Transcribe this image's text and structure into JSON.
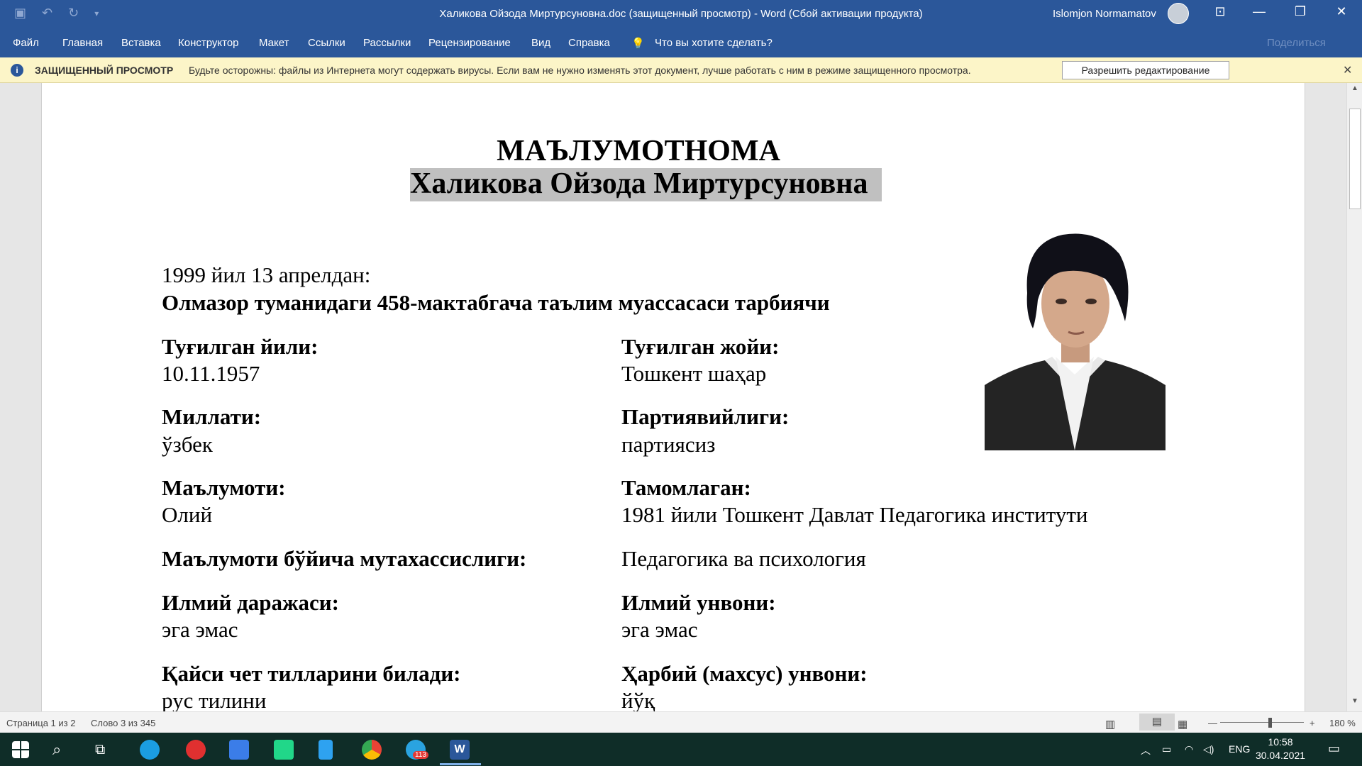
{
  "window": {
    "title": "Халикова Ойзода Миртурсуновна.doc (защищенный просмотр)  -  Word (Сбой активации продукта)",
    "user": "Islomjon Normamatov"
  },
  "menu": [
    "Файл",
    "Главная",
    "Вставка",
    "Конструктор",
    "Макет",
    "Ссылки",
    "Рассылки",
    "Рецензирование",
    "Вид",
    "Справка"
  ],
  "tell_me": "Что вы хотите сделать?",
  "share": "Поделиться",
  "protected": {
    "label": "ЗАЩИЩЕННЫЙ ПРОСМОТР",
    "message": "Будьте осторожны: файлы из Интернета могут содержать вирусы. Если вам не нужно изменять этот документ, лучше работать с ним в режиме защищенного просмотра.",
    "button": "Разрешить редактирование"
  },
  "doc": {
    "heading": "МАЪЛУМОТНОМА",
    "name": "Халикова Ойзода Миртурсуновна",
    "since": "1999 йил 13 апрелдан:",
    "position": "Олмазор туманидаги 458-мактабгача таълим муассасаси тарбиячи",
    "birth_year_label": "Туғилган йили:",
    "birth_year": "10.11.1957",
    "birth_place_label": "Туғилган жойи:",
    "birth_place": "Тошкент шаҳар",
    "nationality_label": "Миллати:",
    "nationality": "ўзбек",
    "party_label": "Партиявийлиги:",
    "party": "партиясиз",
    "education_label": "Маълумоти:",
    "education": "Олий",
    "graduated_label": "Тамомлаган:",
    "graduated": "1981 йили Тошкент Давлат Педагогика институти",
    "speciality_label": "Маълумоти бўйича мутахассислиги:",
    "speciality": "Педагогика ва психология",
    "degree_label": "Илмий даражаси:",
    "degree": "эга эмас",
    "rank_label": "Илмий унвони:",
    "rank": "эга эмас",
    "languages_label": "Қайси чет тилларини билади:",
    "languages": "рус тилини",
    "military_label": "Ҳарбий (махсус) унвони:",
    "military": "йўқ"
  },
  "status": {
    "page": "Страница 1 из 2",
    "words": "Слово 3 из 345",
    "zoom": "180 %"
  },
  "tray": {
    "lang": "ENG",
    "time": "10:58",
    "date": "30.04.2021",
    "telegram_badge": "113"
  }
}
